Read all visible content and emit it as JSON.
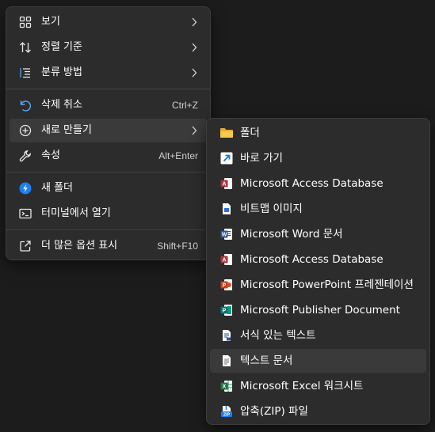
{
  "context_menu": {
    "items": [
      {
        "label": "보기",
        "icon": "grid-view-icon",
        "has_submenu": true
      },
      {
        "label": "정렬 기준",
        "icon": "sort-arrows-icon",
        "has_submenu": true
      },
      {
        "label": "분류 방법",
        "icon": "group-by-list-icon",
        "has_submenu": true
      },
      {
        "label": "삭제 취소",
        "icon": "undo-icon",
        "shortcut": "Ctrl+Z"
      },
      {
        "label": "새로 만들기",
        "icon": "add-circle-icon",
        "has_submenu": true,
        "highlighted": true
      },
      {
        "label": "속성",
        "icon": "wrench-icon",
        "shortcut": "Alt+Enter"
      },
      {
        "label": "새 폴더",
        "icon": "blue-new-folder-icon"
      },
      {
        "label": "터미널에서 열기",
        "icon": "terminal-icon"
      },
      {
        "label": "더 많은 옵션 표시",
        "icon": "share-external-icon",
        "shortcut": "Shift+F10"
      }
    ]
  },
  "new_submenu": {
    "items": [
      {
        "label": "폴더",
        "icon": "folder-icon"
      },
      {
        "label": "바로 가기",
        "icon": "shortcut-arrow-icon"
      },
      {
        "label": "Microsoft Access Database",
        "icon": "access-icon"
      },
      {
        "label": "비트맵 이미지",
        "icon": "bitmap-file-icon"
      },
      {
        "label": "Microsoft Word 문서",
        "icon": "word-icon"
      },
      {
        "label": "Microsoft Access Database",
        "icon": "access-icon"
      },
      {
        "label": "Microsoft PowerPoint 프레젠테이션",
        "icon": "powerpoint-icon"
      },
      {
        "label": "Microsoft Publisher Document",
        "icon": "publisher-icon"
      },
      {
        "label": "서식 있는 텍스트",
        "icon": "rich-text-icon"
      },
      {
        "label": "텍스트 문서",
        "icon": "text-document-icon",
        "highlighted": true
      },
      {
        "label": "Microsoft Excel 워크시트",
        "icon": "excel-icon"
      },
      {
        "label": "압축(ZIP) 파일",
        "icon": "zip-file-icon"
      }
    ]
  },
  "colors": {
    "menu_background": "#2c2c2c",
    "highlight": "#3a3a3a",
    "desktop": "#1c1c1c",
    "folder": "#f2c14e",
    "word": "#2b579a",
    "excel": "#217346",
    "powerpoint": "#c43e1c",
    "access": "#a4373a",
    "publisher": "#077568",
    "accent_blue": "#1e90ff"
  }
}
